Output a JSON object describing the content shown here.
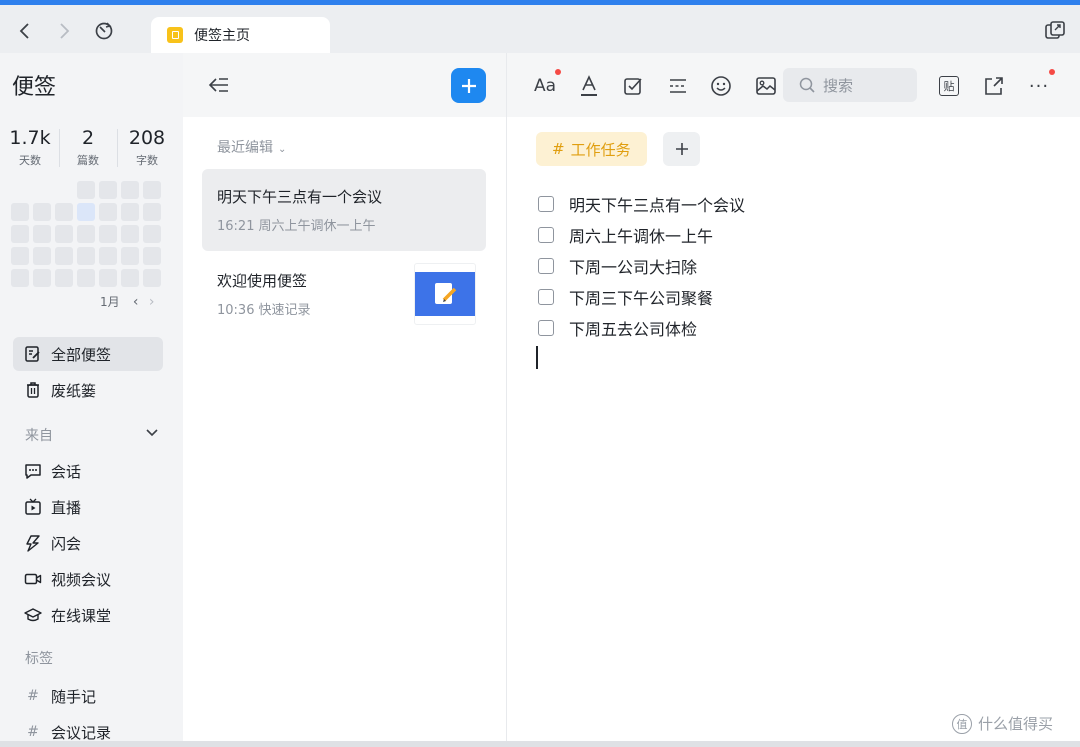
{
  "tabbar": {
    "tab_label": "便签主页"
  },
  "sidebar": {
    "title": "便签",
    "stats": [
      {
        "value": "1.7k",
        "label": "天数"
      },
      {
        "value": "2",
        "label": "篇数"
      },
      {
        "value": "208",
        "label": "字数"
      }
    ],
    "calendar_month": "1月",
    "nav": [
      {
        "label": "全部便签",
        "icon": "notes-edit-icon"
      },
      {
        "label": "废纸篓",
        "icon": "trash-icon"
      }
    ],
    "from_label": "来自",
    "sources": [
      {
        "label": "会话",
        "icon": "chat-icon"
      },
      {
        "label": "直播",
        "icon": "live-tv-icon"
      },
      {
        "label": "闪会",
        "icon": "flash-meeting-icon"
      },
      {
        "label": "视频会议",
        "icon": "video-icon"
      },
      {
        "label": "在线课堂",
        "icon": "graduation-cap-icon"
      }
    ],
    "tags_label": "标签",
    "tags": [
      {
        "label": "随手记"
      },
      {
        "label": "会议记录"
      }
    ]
  },
  "list": {
    "sort_label": "最近编辑",
    "notes": [
      {
        "title": "明天下午三点有一个会议",
        "time": "16:21",
        "preview": "周六上午调休一上午"
      },
      {
        "title": "欢迎使用便签",
        "time": "10:36",
        "preview": "快速记录"
      }
    ]
  },
  "editor": {
    "search_placeholder": "搜索",
    "paste_label": "贴",
    "tag": "工作任务",
    "todos": [
      "明天下午三点有一个会议",
      "周六上午调休一上午",
      "下周一公司大扫除",
      "下周三下午公司聚餐",
      "下周五去公司体检"
    ]
  },
  "watermark": "什么值得买",
  "colors": {
    "accent": "#1e88f0",
    "tag_bg": "#fdf1d3",
    "tag_text": "#e09e0f",
    "badge": "#f54a45"
  }
}
